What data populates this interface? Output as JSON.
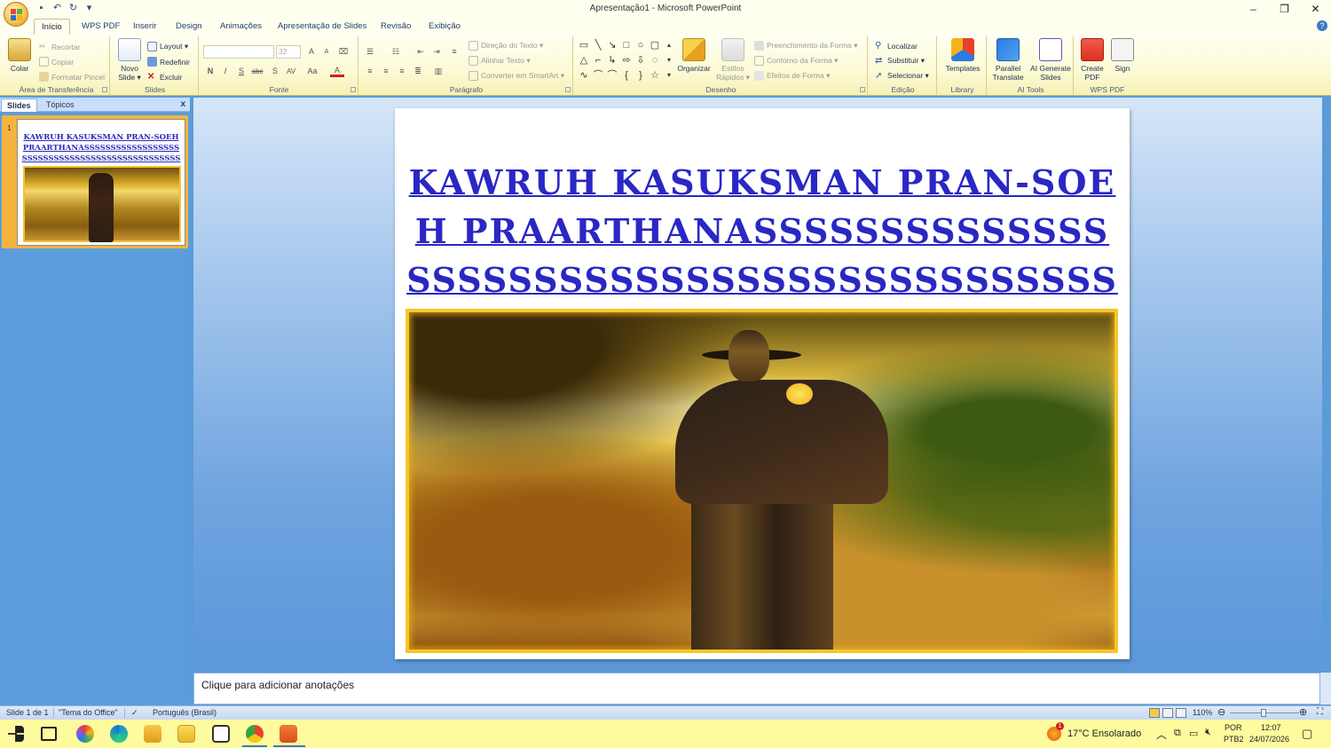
{
  "window": {
    "title": "Apresentação1 - Microsoft PowerPoint",
    "minimize": "–",
    "restore": "❐",
    "close": "✕",
    "qat_customize": "▾"
  },
  "tabs": [
    "Início",
    "WPS PDF",
    "Inserir",
    "Design",
    "Animações",
    "Apresentação de Slides",
    "Revisão",
    "Exibição"
  ],
  "ribbon": {
    "clipboard": {
      "label": "Área de Transferência",
      "paste": "Colar",
      "cut": "Recortar",
      "copy": "Copiar",
      "format_painter": "Formatar Pincel"
    },
    "slides": {
      "label": "Slides",
      "new_slide_1": "Novo",
      "new_slide_2": "Slide ▾",
      "layout": "Layout ▾",
      "reset": "Redefinir",
      "delete": "Excluir"
    },
    "font": {
      "label": "Fonte",
      "size_value": "32",
      "bold": "N",
      "italic": "I",
      "underline": "S",
      "strike": "abc",
      "shadow": "S",
      "spacing": "AV",
      "case": "Aa",
      "color": "A",
      "grow": "A",
      "shrink": "A"
    },
    "paragraph": {
      "label": "Parágrafo",
      "text_direction": "Direção do Texto ▾",
      "align_text": "Alinhar Texto ▾",
      "smartart": "Converter em SmartArt ▾"
    },
    "drawing": {
      "label": "Desenho",
      "arrange": "Organizar",
      "quick_styles_1": "Estilos",
      "quick_styles_2": "Rápidos ▾",
      "shape_fill": "Preenchimento da Forma ▾",
      "shape_outline": "Contorno da Forma ▾",
      "shape_effects": "Efeitos de Forma ▾"
    },
    "editing": {
      "label": "Edição",
      "find": "Localizar",
      "replace": "Substituir ▾",
      "select": "Selecionar ▾"
    },
    "library": {
      "label": "Library",
      "templates": "Templates"
    },
    "ai_tools": {
      "label": "AI Tools",
      "parallel_1": "Parallel",
      "parallel_2": "Translate",
      "generate_1": "AI Generate",
      "generate_2": "Slides"
    },
    "wps_pdf": {
      "label": "WPS PDF",
      "create_1": "Create",
      "create_2": "PDF",
      "sign": "Sign"
    }
  },
  "left_pane": {
    "tab_slides": "Slides",
    "tab_topics": "Tópicos",
    "close": "x",
    "slide_number": "1",
    "thumb_title": "KAWRUH KASUKSMAN PRAN-SOEH PRAARTHANASSSSSSSSSSSSSSSSSSSSSSSSSSSSSSSSSSSSSSSSSSSSSSSSS"
  },
  "slide": {
    "title": "KAWRUH KASUKSMAN PRAN-SOEH PRAARTHANASSSSSSSSSSSSSSSSSSSSSSSSSSSSSSSSSSSSSSSSSSSSSSSSS"
  },
  "notes": {
    "placeholder": "Clique para adicionar anotações"
  },
  "status": {
    "slide": "Slide 1 de 1",
    "theme": "\"Tema do Office\"",
    "language": "Português (Brasil)",
    "zoom": "110%"
  },
  "taskbar": {
    "weather": "17°C  Ensolarado",
    "lang_1": "POR",
    "lang_2": "PTB2",
    "time": "12:07",
    "date": "24/07/2026",
    "weather_badge": "1"
  },
  "colors": {
    "accent": "#3b78c7",
    "title_blue": "#2a27c4",
    "taskbar": "#fdfb9e",
    "ribbon": "#fcfad6"
  }
}
